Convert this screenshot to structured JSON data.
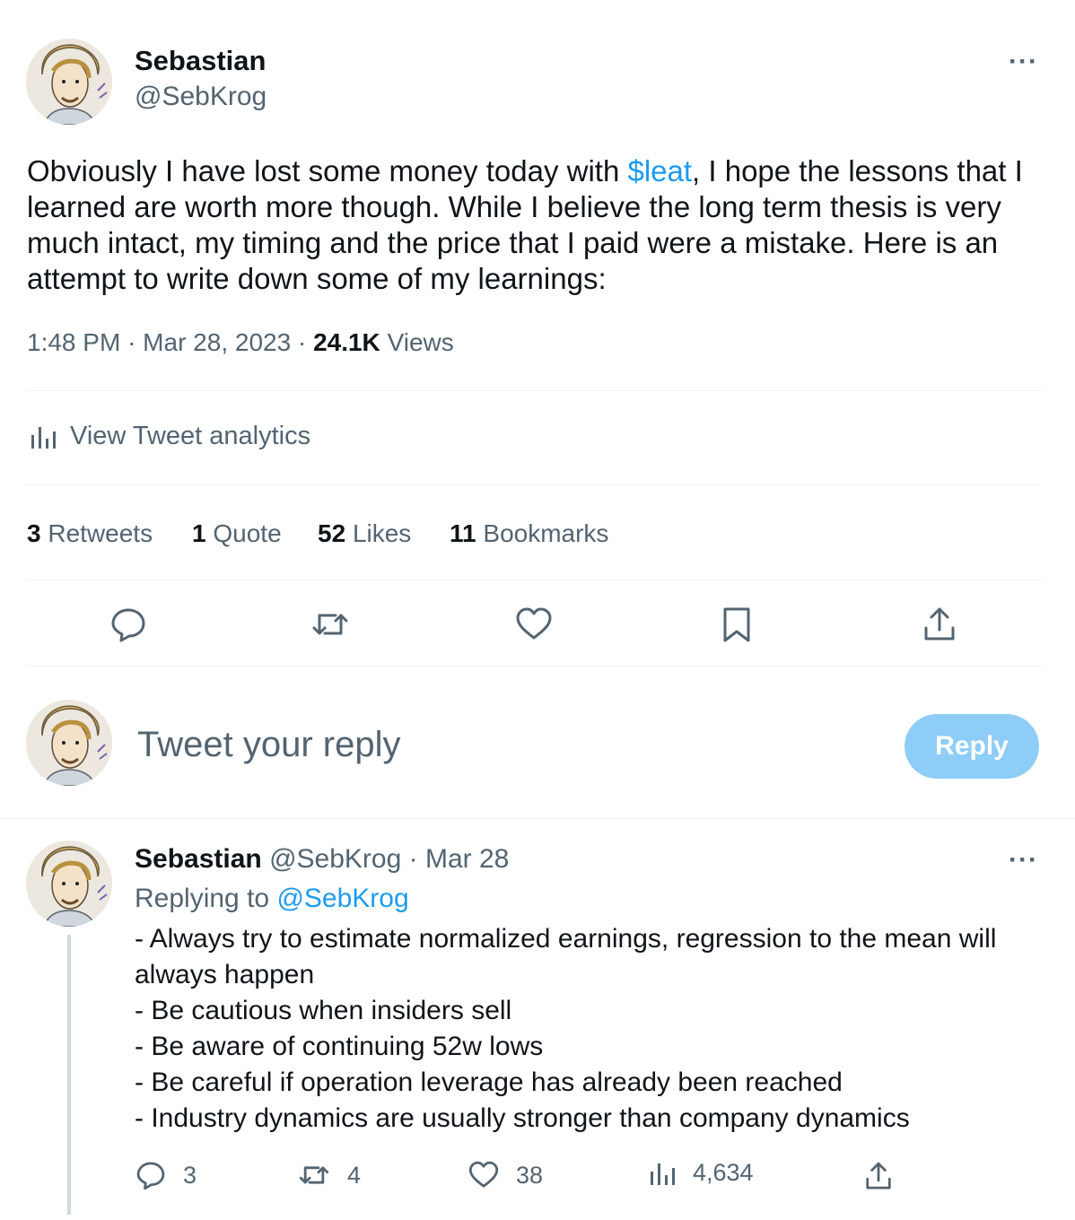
{
  "main_tweet": {
    "author_name": "Sebastian",
    "author_handle": "@SebKrog",
    "more_label": "···",
    "text_before_link": "Obviously I have lost some money today with ",
    "cashtag": "$leat",
    "text_after_link": ", I hope the lessons that I learned are worth more though. While I believe the long term thesis is very much intact, my timing and the price that I paid were a mistake. Here is an attempt to write down some of my learnings:",
    "time": "1:48 PM",
    "separator": "·",
    "date": "Mar 28, 2023",
    "views_count": "24.1K",
    "views_label": "Views",
    "analytics_label": "View Tweet analytics",
    "stats": {
      "retweets_count": "3",
      "retweets_label": "Retweets",
      "quotes_count": "1",
      "quotes_label": "Quote",
      "likes_count": "52",
      "likes_label": "Likes",
      "bookmarks_count": "11",
      "bookmarks_label": "Bookmarks"
    }
  },
  "composer": {
    "placeholder": "Tweet your reply",
    "reply_button": "Reply"
  },
  "reply_tweet": {
    "author_name": "Sebastian",
    "author_handle": "@SebKrog",
    "separator": "·",
    "date": "Mar 28",
    "more_label": "···",
    "replying_to_label": "Replying to",
    "replying_to_handle": "@SebKrog",
    "lines": [
      "- Always try to estimate normalized earnings, regression to the mean will",
      "always happen",
      "- Be cautious when insiders sell",
      "- Be aware of continuing 52w lows",
      "- Be careful if operation leverage has already been reached",
      "- Industry dynamics are usually stronger than company dynamics"
    ],
    "actions": {
      "replies": "3",
      "retweets": "4",
      "likes": "38",
      "views": "4,634"
    }
  },
  "colors": {
    "link": "#1d9bf0",
    "secondary_text": "#536471",
    "reply_button_bg": "#8ecdf8"
  }
}
